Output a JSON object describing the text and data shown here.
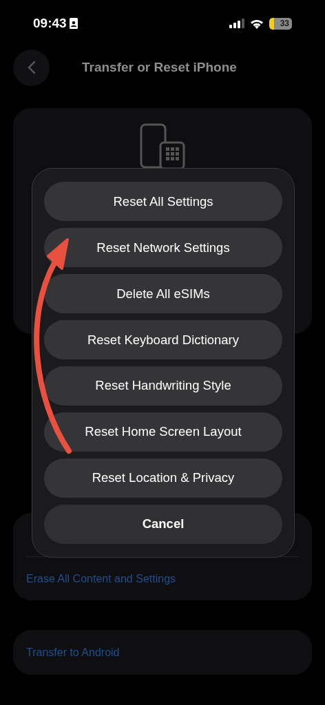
{
  "status_bar": {
    "time": "09:43",
    "battery": "33"
  },
  "nav": {
    "title": "Transfer or Reset iPhone"
  },
  "reset_group": {
    "items": [
      "Erase All Content and Settings"
    ]
  },
  "android_group": {
    "items": [
      "Transfer to Android"
    ]
  },
  "dialog": {
    "options": [
      {
        "label": "Reset All Settings",
        "kind": "action"
      },
      {
        "label": "Reset Network Settings",
        "kind": "action"
      },
      {
        "label": "Delete All eSIMs",
        "kind": "action"
      },
      {
        "label": "Reset Keyboard Dictionary",
        "kind": "action"
      },
      {
        "label": "Reset Handwriting Style",
        "kind": "action"
      },
      {
        "label": "Reset Home Screen Layout",
        "kind": "action"
      },
      {
        "label": "Reset Location & Privacy",
        "kind": "action"
      },
      {
        "label": "Cancel",
        "kind": "cancel"
      }
    ]
  }
}
